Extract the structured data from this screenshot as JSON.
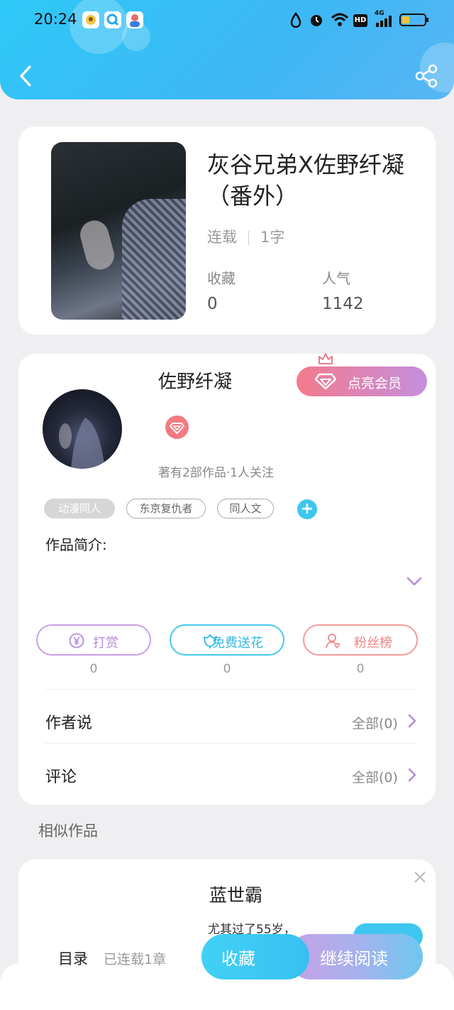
{
  "status_bar": {
    "time": "20:24",
    "network": "4G",
    "hd": "HD"
  },
  "book": {
    "title": "灰谷兄弟X佐野纤凝（番外）",
    "status": "连载",
    "word_count": "1字",
    "favorites_label": "收藏",
    "favorites_value": "0",
    "popularity_label": "人气",
    "popularity_value": "1142"
  },
  "author": {
    "name": "佐野纤凝",
    "vip_button": "点亮会员",
    "works_info": "著有2部作品·1人关注",
    "tags": [
      "动漫同人",
      "东京复仇者",
      "同人文"
    ],
    "plus": "+"
  },
  "intro_label": "作品简介:",
  "actions": [
    {
      "label": "打赏",
      "count": "0",
      "color": "#c9a0e8",
      "icon": "yen-coin-icon"
    },
    {
      "label": "免费送花",
      "count": "0",
      "color": "#44c9ee",
      "icon": "flower-icon"
    },
    {
      "label": "粉丝榜",
      "count": "0",
      "color": "#f29c9c",
      "icon": "fan-user-icon"
    }
  ],
  "rows": {
    "author_says": {
      "label": "作者说",
      "value": "全部(0)"
    },
    "comments": {
      "label": "评论",
      "value": "全部(0)"
    }
  },
  "similar": {
    "heading": "相似作品",
    "title": "蓝世霸",
    "snippet": "尤其过了55岁，"
  },
  "bottom_bar": {
    "toc": "目录",
    "chapters": "已连载1章",
    "favorite": "收藏",
    "continue": "继续阅读"
  },
  "colors": {
    "header": "#38bff4",
    "accent_blue": "#3ec6f0",
    "vip_gradient_start": "#f47a8c",
    "vip_gradient_end": "#c48fdf",
    "chevron": "#b38ad9"
  }
}
